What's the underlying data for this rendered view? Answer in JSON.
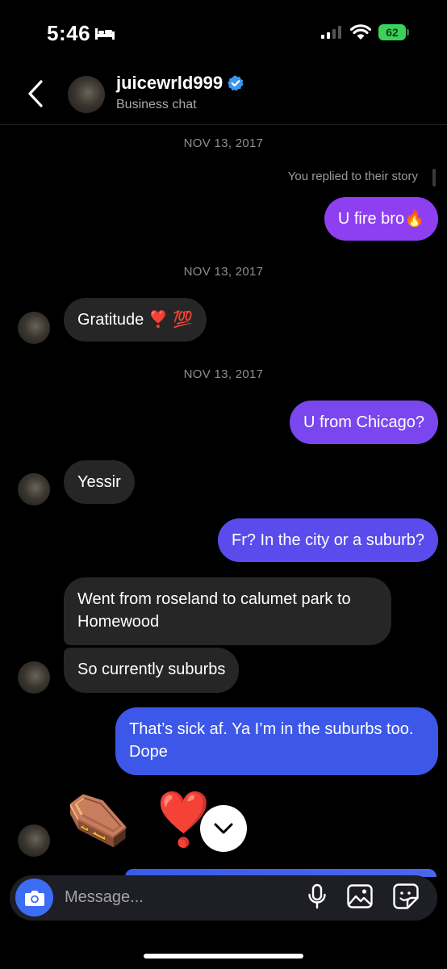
{
  "status_bar": {
    "time": "5:46",
    "battery": "62"
  },
  "header": {
    "username": "juicewrld999",
    "subtitle": "Business chat"
  },
  "thread": {
    "dates": [
      "NOV 13, 2017",
      "NOV 13, 2017",
      "NOV 13, 2017"
    ],
    "story_reply_note": "You replied to their story",
    "messages": [
      {
        "side": "out",
        "text": "U fire bro🔥"
      },
      {
        "side": "in",
        "text": "Gratitude ❣️ 💯"
      },
      {
        "side": "out",
        "text": "U from Chicago?"
      },
      {
        "side": "in",
        "text": "Yessir"
      },
      {
        "side": "out",
        "text": "Fr? In the city or a suburb?"
      },
      {
        "side": "in",
        "text": "Went from roseland to calumet park to Homewood"
      },
      {
        "side": "in",
        "text": "So currently suburbs"
      },
      {
        "side": "out",
        "text": "That’s sick af. Ya I’m in the suburbs too. Dope"
      },
      {
        "side": "in",
        "text": "⚰️ ❣️"
      }
    ]
  },
  "composer": {
    "placeholder": "Message..."
  },
  "colors": {
    "accent": "#3d6cf5",
    "bubble_in": "#262626",
    "bubble_out_top": "#8f3ff2",
    "bubble_out_bottom": "#3d55e8"
  }
}
